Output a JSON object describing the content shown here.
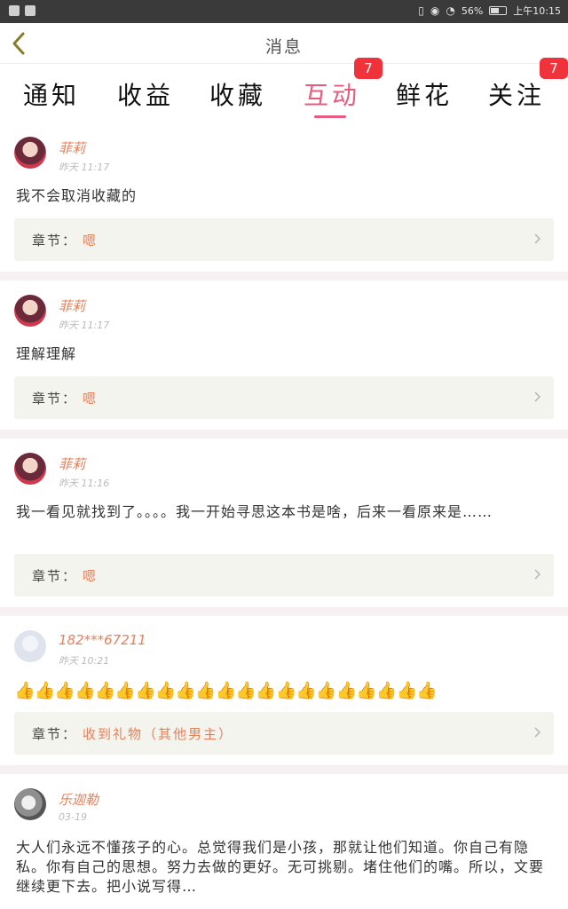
{
  "status_bar": {
    "battery_percent": "56%",
    "time": "上午10:15",
    "battery_level": 0.56
  },
  "header": {
    "title": "消息",
    "back_icon": "chevron-left-icon"
  },
  "tabs": [
    {
      "label": "通知",
      "badge": ""
    },
    {
      "label": "收益",
      "badge": ""
    },
    {
      "label": "收藏",
      "badge": ""
    },
    {
      "label": "互动",
      "badge": "7",
      "active": true
    },
    {
      "label": "鲜花",
      "badge": ""
    },
    {
      "label": "关注",
      "badge": "7"
    }
  ],
  "colors": {
    "accent": "#e85b7e",
    "name": "#e7805a",
    "badge": "#f0323a"
  },
  "chapter_label": "章节：",
  "messages": [
    {
      "user": "菲莉",
      "time": "昨天 11:17",
      "text": "我不会取消收藏的",
      "chapter": "嗯"
    },
    {
      "user": "菲莉",
      "time": "昨天 11:17",
      "text": "理解理解",
      "chapter": "嗯"
    },
    {
      "user": "菲莉",
      "time": "昨天 11:16",
      "text": "我一看见就找到了。。。。我一开始寻思这本书是啥，后来一看原来是……",
      "chapter": "嗯"
    },
    {
      "user": "182***67211",
      "time": "昨天 10:21",
      "text": "👍👍👍👍👍👍👍👍👍👍👍👍👍👍👍👍👍👍👍👍👍",
      "chapter": "收到礼物（其他男主）"
    },
    {
      "user": "乐迦勒",
      "time": "03-19",
      "text": "大人们永远不懂孩子的心。总觉得我们是小孩，那就让他们知道。你自己有隐私。你有自己的思想。努力去做的更好。无可挑剔。堵住他们的嘴。所以，文要继续更下去。把小说写得…"
    }
  ]
}
